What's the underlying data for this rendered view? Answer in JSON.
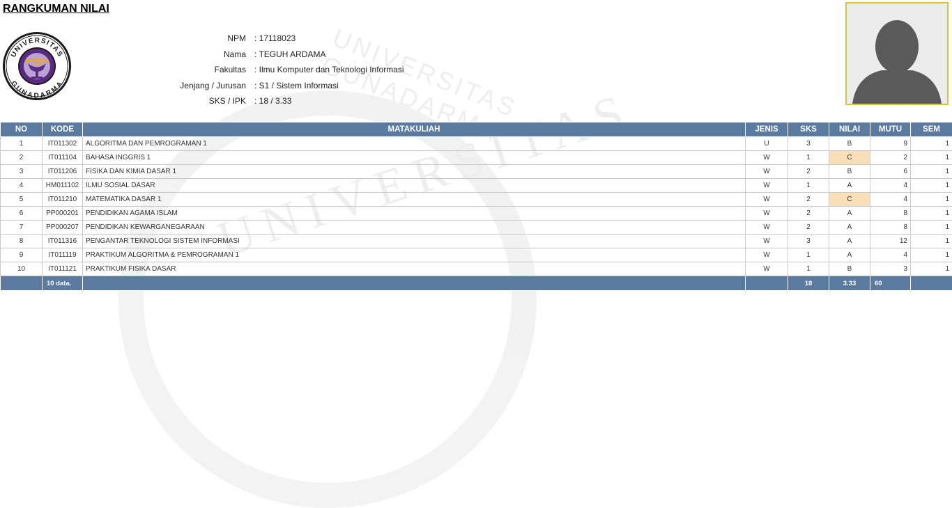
{
  "header": {
    "title": "RANGKUMAN NILAI"
  },
  "watermark": {
    "arc_text": "UNIVERSITAS GUNADARMA",
    "big_text": "UNIVERSITAS"
  },
  "logo": {
    "top_text": "UNIVERSITAS",
    "bottom_text": "GUNADARMA"
  },
  "student": {
    "fields": [
      {
        "label": "NPM",
        "value": ": 17118023"
      },
      {
        "label": "Nama",
        "value": ": TEGUH ARDAMA"
      },
      {
        "label": "Fakultas",
        "value": ": Ilmu Komputer dan Teknologi Informasi"
      },
      {
        "label": "Jenjang / Jurusan",
        "value": ": S1 / Sistem Informasi"
      },
      {
        "label": "SKS / IPK",
        "value": ": 18 / 3.33"
      }
    ]
  },
  "table": {
    "columns": [
      "NO",
      "KODE",
      "MATAKULIAH",
      "JENIS",
      "SKS",
      "NILAI",
      "MUTU",
      "SEM"
    ],
    "rows": [
      {
        "no": "1",
        "kode": "IT011302",
        "matakuliah": "ALGORITMA DAN PEMROGRAMAN 1",
        "jenis": "U",
        "sks": "3",
        "nilai": "B",
        "mutu": "9",
        "sem": "1"
      },
      {
        "no": "2",
        "kode": "IT011104",
        "matakuliah": "BAHASA INGGRIS 1",
        "jenis": "W",
        "sks": "1",
        "nilai": "C",
        "mutu": "2",
        "sem": "1"
      },
      {
        "no": "3",
        "kode": "IT011206",
        "matakuliah": "FISIKA DAN KIMIA DASAR 1",
        "jenis": "W",
        "sks": "2",
        "nilai": "B",
        "mutu": "6",
        "sem": "1"
      },
      {
        "no": "4",
        "kode": "HM011102",
        "matakuliah": "ILMU SOSIAL DASAR",
        "jenis": "W",
        "sks": "1",
        "nilai": "A",
        "mutu": "4",
        "sem": "1"
      },
      {
        "no": "5",
        "kode": "IT011210",
        "matakuliah": "MATEMATIKA DASAR 1",
        "jenis": "W",
        "sks": "2",
        "nilai": "C",
        "mutu": "4",
        "sem": "1"
      },
      {
        "no": "6",
        "kode": "PP000201",
        "matakuliah": "PENDIDIKAN AGAMA ISLAM",
        "jenis": "W",
        "sks": "2",
        "nilai": "A",
        "mutu": "8",
        "sem": "1"
      },
      {
        "no": "7",
        "kode": "PP000207",
        "matakuliah": "PENDIDIKAN KEWARGANEGARAAN",
        "jenis": "W",
        "sks": "2",
        "nilai": "A",
        "mutu": "8",
        "sem": "1"
      },
      {
        "no": "8",
        "kode": "IT011316",
        "matakuliah": "PENGANTAR TEKNOLOGI SISTEM INFORMASI",
        "jenis": "W",
        "sks": "3",
        "nilai": "A",
        "mutu": "12",
        "sem": "1"
      },
      {
        "no": "9",
        "kode": "IT011119",
        "matakuliah": "PRAKTIKUM ALGORITMA & PEMROGRAMAN 1",
        "jenis": "W",
        "sks": "1",
        "nilai": "A",
        "mutu": "4",
        "sem": "1"
      },
      {
        "no": "10",
        "kode": "IT011121",
        "matakuliah": "PRAKTIKUM FISIKA DASAR",
        "jenis": "W",
        "sks": "1",
        "nilai": "B",
        "mutu": "3",
        "sem": "1"
      }
    ],
    "footer": {
      "count": "10 data.",
      "total_sks": "18",
      "ipk": "3.33",
      "total_mutu": "60"
    }
  },
  "colors": {
    "header_bg": "#5a7aa0",
    "highlight_c": "#f9dfb8",
    "logo_purple": "#5b2a82",
    "logo_lavender": "#b8a3d3",
    "logo_orange": "#f2a71b",
    "photo_border": "#d9c04a"
  },
  "icons": {
    "logo": "gunadarma-logo",
    "photo": "profile-placeholder-icon"
  }
}
